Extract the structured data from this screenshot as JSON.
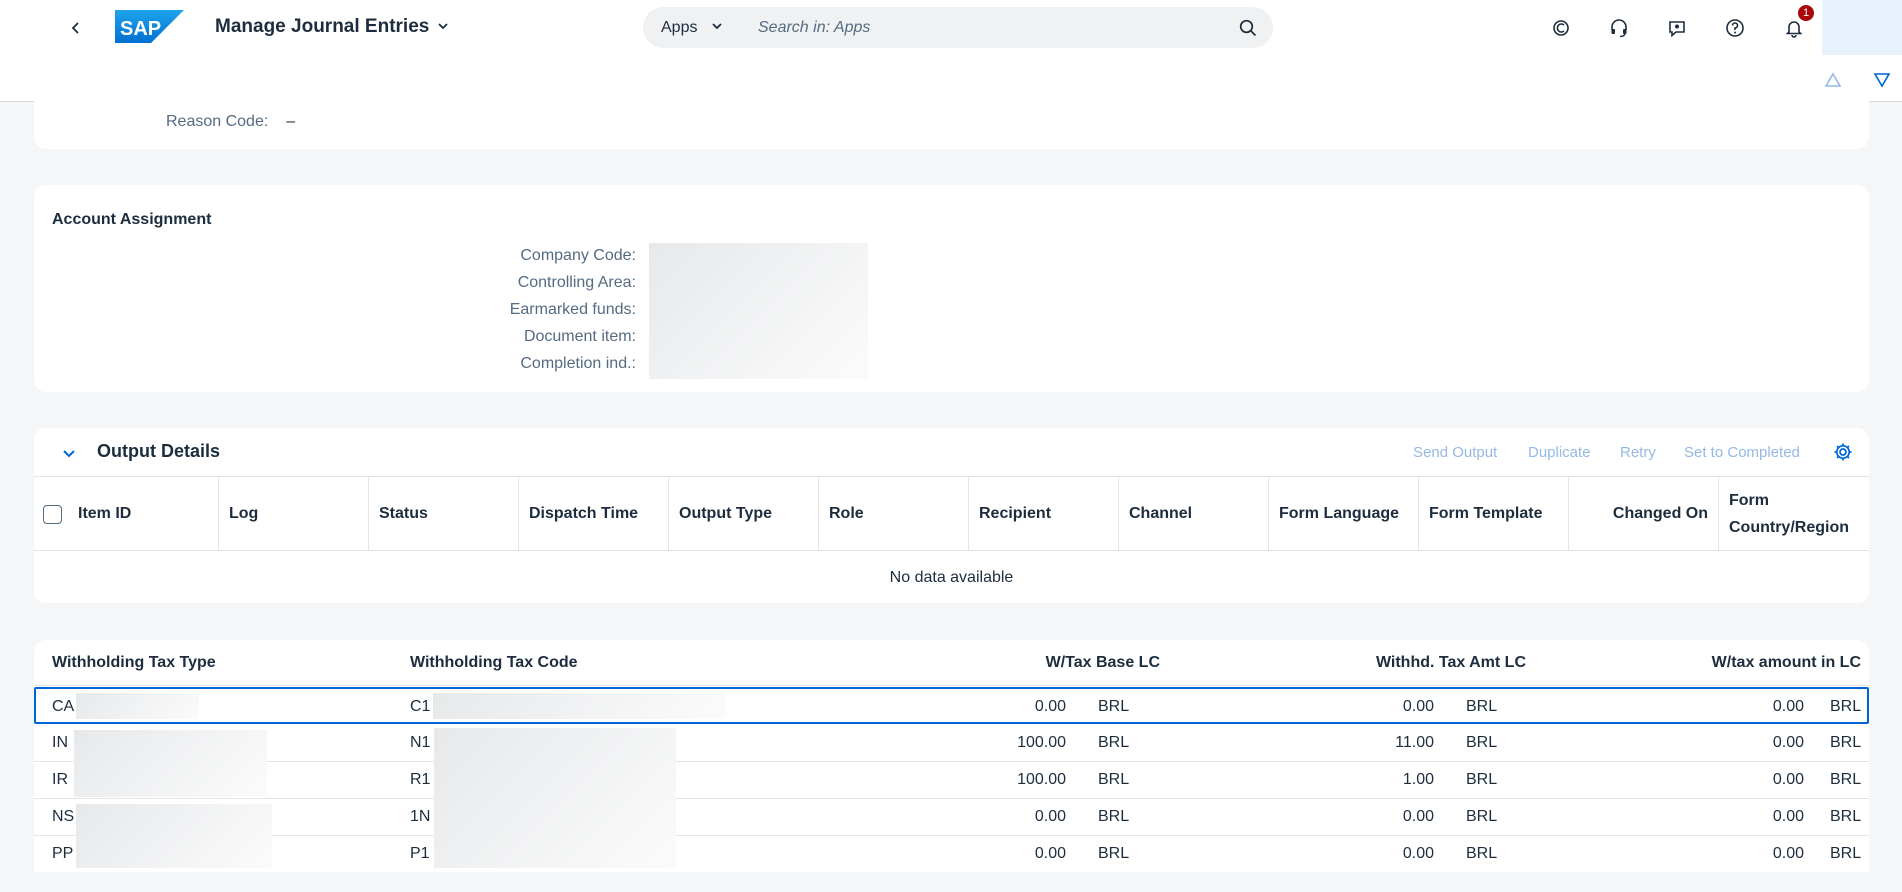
{
  "shell": {
    "app_title": "Manage Journal Entries",
    "logo_text": "SAP",
    "search_scope": "Apps",
    "search_placeholder": "Search in: Apps",
    "notification_count": "1",
    "icons": [
      "back-icon",
      "joule-icon",
      "headset-icon",
      "feedback-icon",
      "help-icon",
      "bell-icon"
    ]
  },
  "reason": {
    "label": "Reason Code:",
    "value": "–"
  },
  "account_assignment": {
    "title": "Account Assignment",
    "fields": [
      {
        "label": "Company Code:"
      },
      {
        "label": "Controlling Area:"
      },
      {
        "label": "Earmarked funds:"
      },
      {
        "label": "Document item:"
      },
      {
        "label": "Completion ind.:"
      }
    ]
  },
  "output_details": {
    "title": "Output Details",
    "actions": [
      "Send Output",
      "Duplicate",
      "Retry",
      "Set to Completed"
    ],
    "columns": [
      "Item ID",
      "Log",
      "Status",
      "Dispatch Time",
      "Output Type",
      "Role",
      "Recipient",
      "Channel",
      "Form Language",
      "Form Template",
      "Changed On",
      "Form Country/Region"
    ],
    "empty_text": "No data available"
  },
  "withholding_tax": {
    "columns": [
      "Withholding Tax Type",
      "Withholding Tax Code",
      "W/Tax Base LC",
      "Withhd. Tax Amt LC",
      "W/tax amount in LC"
    ],
    "rows": [
      {
        "type": "CA",
        "code": "C1",
        "base": "0.00",
        "base_cur": "BRL",
        "amt": "0.00",
        "amt_cur": "BRL",
        "lc": "0.00",
        "lc_cur": "BRL"
      },
      {
        "type": "IN",
        "code": "N1",
        "base": "100.00",
        "base_cur": "BRL",
        "amt": "11.00",
        "amt_cur": "BRL",
        "lc": "0.00",
        "lc_cur": "BRL"
      },
      {
        "type": "IR",
        "code": "R1",
        "base": "100.00",
        "base_cur": "BRL",
        "amt": "1.00",
        "amt_cur": "BRL",
        "lc": "0.00",
        "lc_cur": "BRL"
      },
      {
        "type": "NS",
        "code": "1N",
        "base": "0.00",
        "base_cur": "BRL",
        "amt": "0.00",
        "amt_cur": "BRL",
        "lc": "0.00",
        "lc_cur": "BRL"
      },
      {
        "type": "PP",
        "code": "P1",
        "base": "0.00",
        "base_cur": "BRL",
        "amt": "0.00",
        "amt_cur": "BRL",
        "lc": "0.00",
        "lc_cur": "BRL"
      }
    ]
  },
  "colors": {
    "accent": "#0064d9",
    "disabled_link": "#95b9e4",
    "badge": "#aa0808",
    "background": "#f5f6f7"
  }
}
